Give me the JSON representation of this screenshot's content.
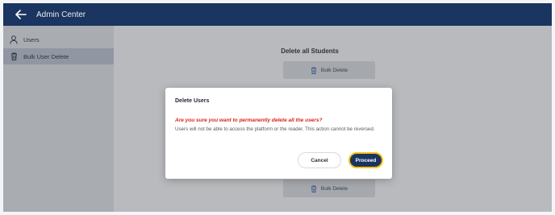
{
  "header": {
    "title": "Admin Center",
    "back_icon": "arrow-left-icon",
    "background": "#1a3560"
  },
  "sidebar": {
    "items": [
      {
        "label": "Users",
        "icon": "user-icon",
        "active": false
      },
      {
        "label": "Bulk User Delete",
        "icon": "trash-icon",
        "active": true
      }
    ]
  },
  "main": {
    "section_title": "Delete all Students",
    "buttons": [
      {
        "label": "Bulk Delete",
        "icon": "trash-icon"
      },
      {
        "label": "Bulk Delete",
        "icon": "trash-icon"
      }
    ]
  },
  "modal": {
    "title": "Delete Users",
    "warning": "Are you sure you want to permanently delete all the users?",
    "body": "Users will not be able to access the platform or the reader. This action cannot be reversed.",
    "cancel_label": "Cancel",
    "proceed_label": "Proceed",
    "warning_color": "#d7261e",
    "proceed_border_color": "#f2c419"
  }
}
